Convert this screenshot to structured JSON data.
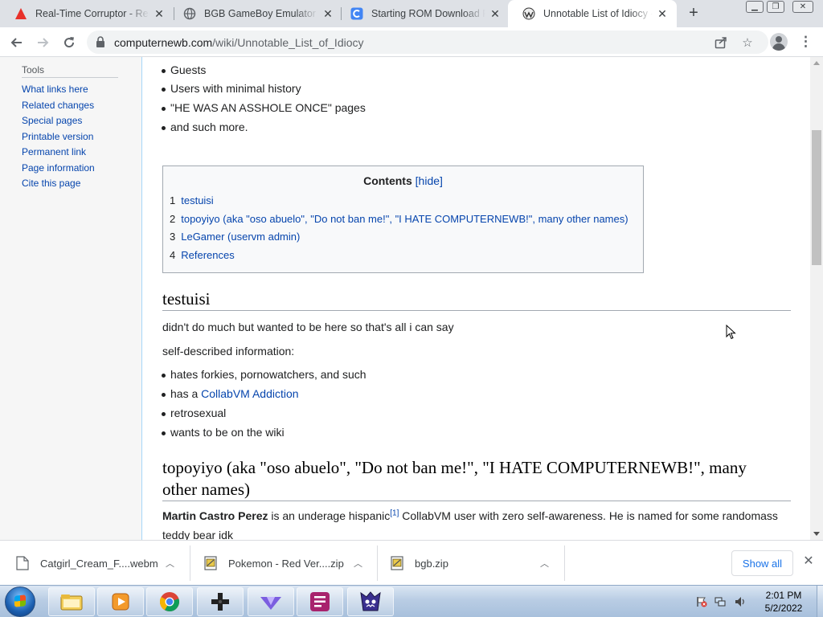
{
  "browser": {
    "tabs": [
      {
        "title": "Real-Time Corruptor - Reds",
        "icon": "red-triangle-icon"
      },
      {
        "title": "BGB GameBoy Emulator (c",
        "icon": "globe-icon"
      },
      {
        "title": "Starting ROM Download Pa",
        "icon": "refresh-c-icon"
      },
      {
        "title": "Unnotable List of Idiocy - C",
        "icon": "wiki-icon",
        "active": true
      }
    ],
    "address": {
      "domain": "computernewb.com",
      "path": "/wiki/Unnotable_List_of_Idiocy"
    }
  },
  "sidebar": {
    "heading": "Tools",
    "items": [
      "What links here",
      "Related changes",
      "Special pages",
      "Printable version",
      "Permanent link",
      "Page information",
      "Cite this page"
    ]
  },
  "article": {
    "top_bullets": [
      "Guests",
      "Users with minimal history",
      "\"HE WAS AN ASSHOLE ONCE\" pages",
      "and such more."
    ],
    "toc": {
      "title": "Contents",
      "hide_label": "[hide]",
      "entries": [
        {
          "num": "1",
          "text": "testuisi"
        },
        {
          "num": "2",
          "text": "topoyiyo (aka \"oso abuelo\", \"Do not ban me!\", \"I HATE COMPUTERNEWB!\", many other names)"
        },
        {
          "num": "3",
          "text": "LeGamer (uservm admin)"
        },
        {
          "num": "4",
          "text": "References"
        }
      ]
    },
    "section1": {
      "heading": "testuisi",
      "para": "didn't do much but wanted to be here so that's all i can say",
      "para2": "self-described information:",
      "bullets": [
        {
          "text": "hates forkies, pornowatchers, and such"
        },
        {
          "pre": "has a ",
          "link": "CollabVM Addiction"
        },
        {
          "text": "retrosexual"
        },
        {
          "text": "wants to be on the wiki"
        }
      ]
    },
    "section2": {
      "heading_line1": "topoyiyo (aka \"oso abuelo\", \"Do not ban me!\", \"I HATE COMPUTERNEWB!\", many",
      "heading_line2": "other names)",
      "bold_name": "Martin Castro Perez",
      "text_a": " is an underage hispanic",
      "ref": "[1]",
      "text_b": " CollabVM user with zero self-awareness. He is named for some randomass",
      "text_c": "teddy bear idk"
    }
  },
  "downloads": [
    {
      "name": "Catgirl_Cream_F....webm",
      "icon": "file-icon"
    },
    {
      "name": "Pokemon - Red Ver....zip",
      "icon": "zip-icon"
    },
    {
      "name": "bgb.zip",
      "icon": "zip-icon"
    }
  ],
  "show_all_label": "Show all",
  "taskbar": {
    "apps": [
      "explorer-icon",
      "media-player-icon",
      "chrome-icon",
      "emulator-icon",
      "corruptor-icon",
      "editor-icon",
      "game-icon"
    ],
    "time": "2:01 PM",
    "date": "5/2/2022"
  },
  "colors": {
    "link": "#0645ad",
    "tab_bg": "#dee1e6",
    "accent": "#1a73e8"
  }
}
